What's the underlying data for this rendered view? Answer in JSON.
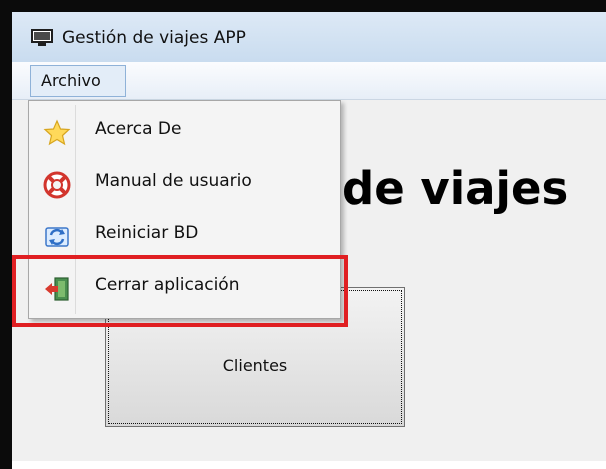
{
  "window": {
    "title": "Gestión de viajes APP"
  },
  "menubar": {
    "archivo": "Archivo"
  },
  "dropdown": {
    "items": [
      {
        "label": "Acerca De",
        "icon": "star-icon"
      },
      {
        "label": "Manual de usuario",
        "icon": "lifebuoy-icon"
      },
      {
        "label": "Reiniciar BD",
        "icon": "refresh-icon"
      },
      {
        "label": "Cerrar aplicación",
        "icon": "exit-door-icon"
      }
    ]
  },
  "main": {
    "heading_fragment": "de viajes",
    "clientes_button": "Clientes"
  },
  "colors": {
    "highlight": "#e01f22"
  }
}
